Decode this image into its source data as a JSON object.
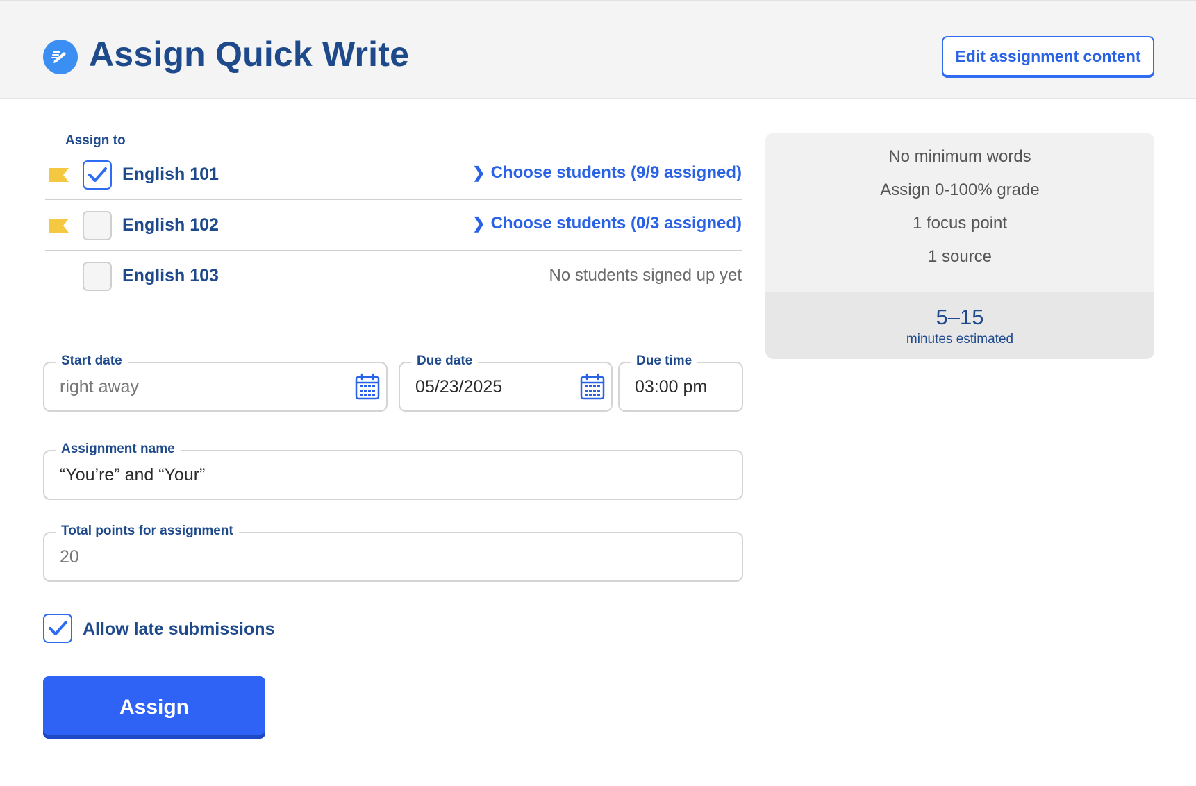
{
  "header": {
    "title": "Assign Quick Write",
    "icon": "quick-write-pen-icon",
    "edit_button": "Edit assignment content"
  },
  "assign_to": {
    "legend": "Assign to",
    "classes": [
      {
        "name": "English 101",
        "checked": true,
        "flagged": true,
        "link": "Choose students (9/9 assigned)"
      },
      {
        "name": "English 102",
        "checked": false,
        "flagged": true,
        "link": "Choose students (0/3 assigned)"
      },
      {
        "name": "English 103",
        "checked": false,
        "flagged": false,
        "status": "No students signed up yet"
      }
    ]
  },
  "dates": {
    "start": {
      "label": "Start date",
      "placeholder": "right away"
    },
    "due": {
      "label": "Due date",
      "value": "05/23/2025"
    },
    "time": {
      "label": "Due time",
      "value": "03:00 pm"
    }
  },
  "assignment_name": {
    "label": "Assignment name",
    "value": "“You’re” and “Your”"
  },
  "total_points": {
    "label": "Total points for assignment",
    "value": "20"
  },
  "late_submissions": {
    "label": "Allow late submissions",
    "checked": true
  },
  "assign_button": "Assign",
  "info": {
    "lines": [
      "No minimum words",
      "Assign 0-100% grade",
      "1 focus point",
      "1 source"
    ],
    "estimate_value": "5–15",
    "estimate_label": "minutes estimated"
  },
  "colors": {
    "primary": "#2e63f5",
    "heading": "#1e4a8c",
    "flag": "#f5c842",
    "header_bg": "#f4f4f4"
  }
}
